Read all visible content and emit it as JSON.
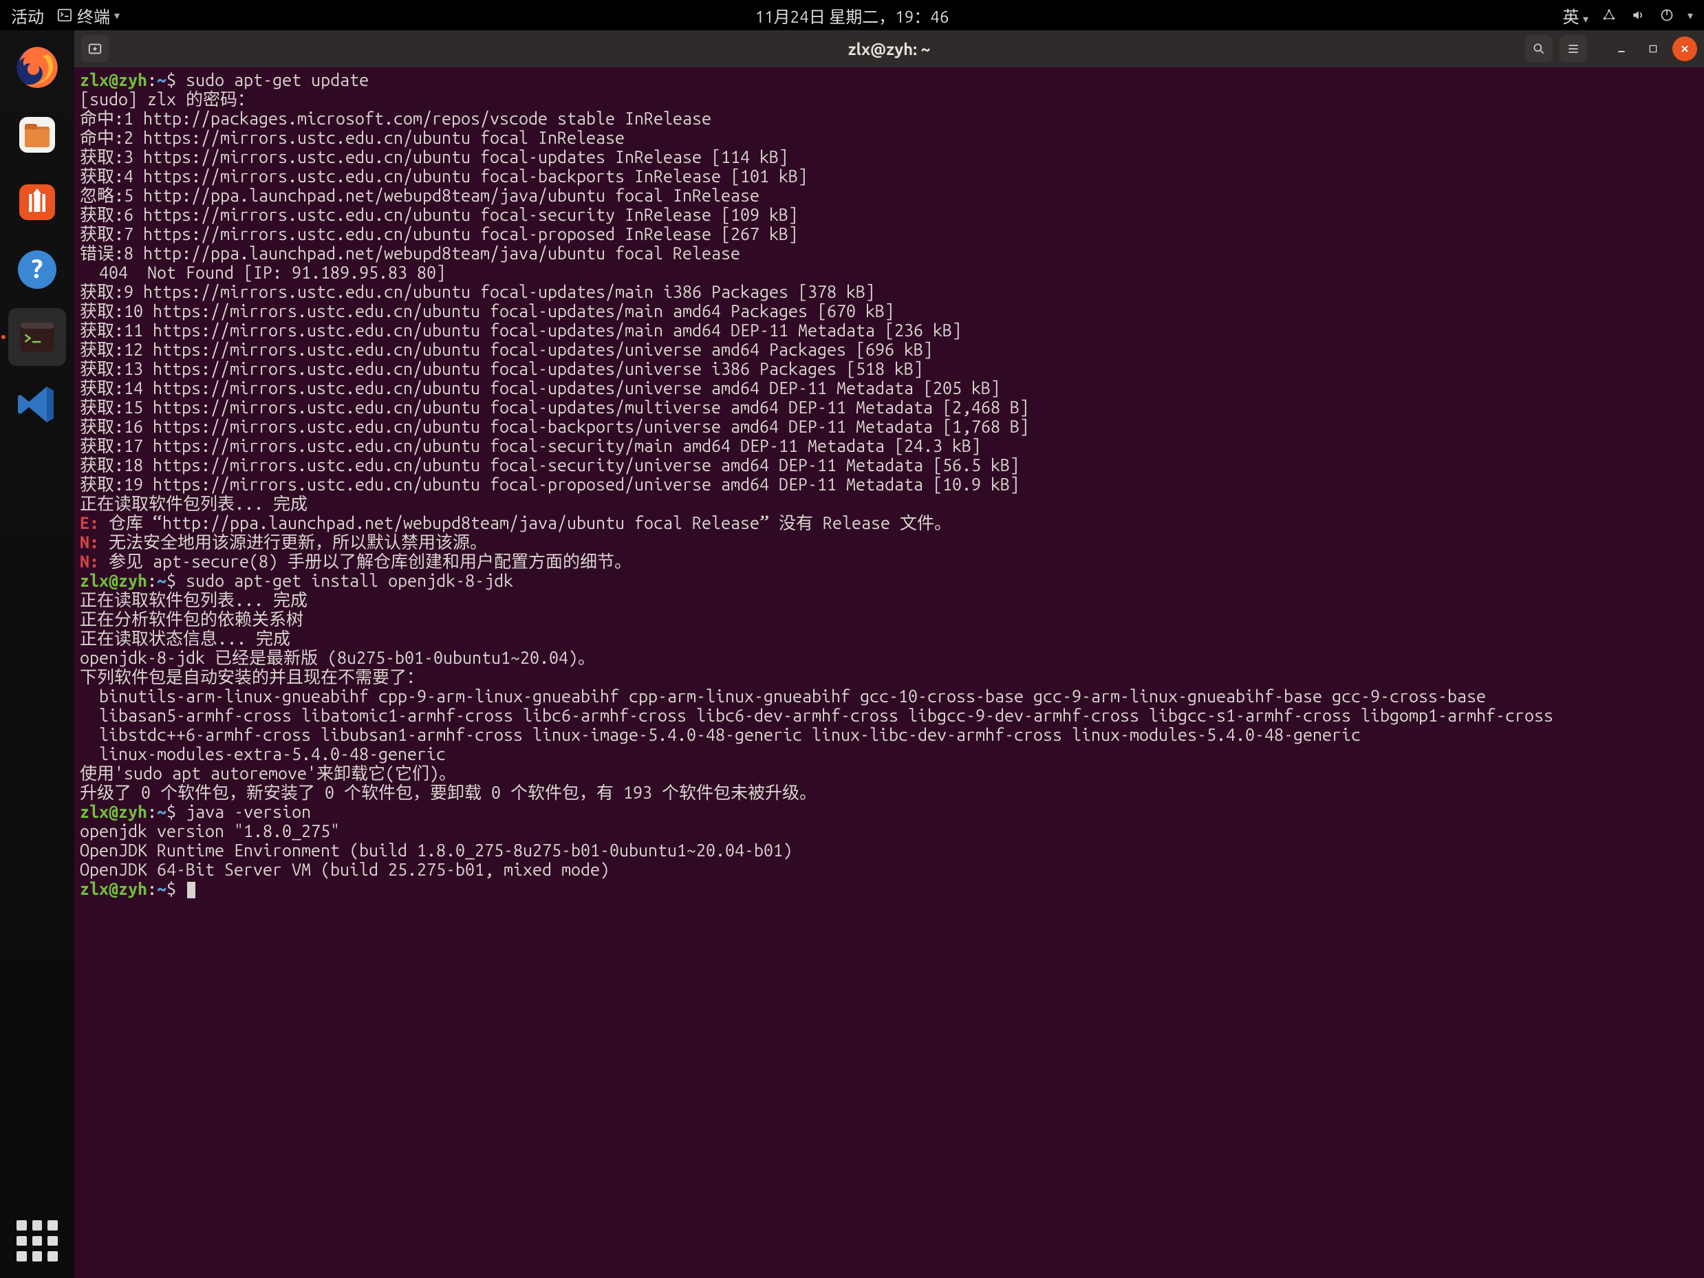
{
  "topbar": {
    "activities": "活动",
    "app_name": "终端",
    "clock": "11月24日 星期二，19：46",
    "input_method": "英"
  },
  "window": {
    "title": "zlx@zyh: ~"
  },
  "prompt": {
    "user_host": "zlx@zyh",
    "sep1": ":",
    "path": "~",
    "dollar": "$"
  },
  "commands": {
    "c1": " sudo apt-get update",
    "c2": " sudo apt-get install openjdk-8-jdk",
    "c3": " java -version"
  },
  "output": {
    "l01": "[sudo] zlx 的密码：",
    "l02": "命中:1 http://packages.microsoft.com/repos/vscode stable InRelease",
    "l03": "命中:2 https://mirrors.ustc.edu.cn/ubuntu focal InRelease",
    "l04": "获取:3 https://mirrors.ustc.edu.cn/ubuntu focal-updates InRelease [114 kB]",
    "l05": "获取:4 https://mirrors.ustc.edu.cn/ubuntu focal-backports InRelease [101 kB]",
    "l06": "忽略:5 http://ppa.launchpad.net/webupd8team/java/ubuntu focal InRelease",
    "l07": "获取:6 https://mirrors.ustc.edu.cn/ubuntu focal-security InRelease [109 kB]",
    "l08": "获取:7 https://mirrors.ustc.edu.cn/ubuntu focal-proposed InRelease [267 kB]",
    "l09": "错误:8 http://ppa.launchpad.net/webupd8team/java/ubuntu focal Release",
    "l10": "  404  Not Found [IP: 91.189.95.83 80]",
    "l11": "获取:9 https://mirrors.ustc.edu.cn/ubuntu focal-updates/main i386 Packages [378 kB]",
    "l12": "获取:10 https://mirrors.ustc.edu.cn/ubuntu focal-updates/main amd64 Packages [670 kB]",
    "l13": "获取:11 https://mirrors.ustc.edu.cn/ubuntu focal-updates/main amd64 DEP-11 Metadata [236 kB]",
    "l14": "获取:12 https://mirrors.ustc.edu.cn/ubuntu focal-updates/universe amd64 Packages [696 kB]",
    "l15": "获取:13 https://mirrors.ustc.edu.cn/ubuntu focal-updates/universe i386 Packages [518 kB]",
    "l16": "获取:14 https://mirrors.ustc.edu.cn/ubuntu focal-updates/universe amd64 DEP-11 Metadata [205 kB]",
    "l17": "获取:15 https://mirrors.ustc.edu.cn/ubuntu focal-updates/multiverse amd64 DEP-11 Metadata [2,468 B]",
    "l18": "获取:16 https://mirrors.ustc.edu.cn/ubuntu focal-backports/universe amd64 DEP-11 Metadata [1,768 B]",
    "l19": "获取:17 https://mirrors.ustc.edu.cn/ubuntu focal-security/main amd64 DEP-11 Metadata [24.3 kB]",
    "l20": "获取:18 https://mirrors.ustc.edu.cn/ubuntu focal-security/universe amd64 DEP-11 Metadata [56.5 kB]",
    "l21": "获取:19 https://mirrors.ustc.edu.cn/ubuntu focal-proposed/universe amd64 DEP-11 Metadata [10.9 kB]",
    "l22": "正在读取软件包列表... 完成",
    "l23_e": "E: ",
    "l23": "仓库 “http://ppa.launchpad.net/webupd8team/java/ubuntu focal Release” 没有 Release 文件。",
    "l24_n": "N: ",
    "l24": "无法安全地用该源进行更新，所以默认禁用该源。",
    "l25_n": "N: ",
    "l25": "参见 apt-secure(8) 手册以了解仓库创建和用户配置方面的细节。",
    "l26": "正在读取软件包列表... 完成",
    "l27": "正在分析软件包的依赖关系树       ",
    "l28": "正在读取状态信息... 完成       ",
    "l29": "openjdk-8-jdk 已经是最新版 (8u275-b01-0ubuntu1~20.04)。",
    "l30": "下列软件包是自动安装的并且现在不需要了：",
    "l31": "  binutils-arm-linux-gnueabihf cpp-9-arm-linux-gnueabihf cpp-arm-linux-gnueabihf gcc-10-cross-base gcc-9-arm-linux-gnueabihf-base gcc-9-cross-base",
    "l32": "  libasan5-armhf-cross libatomic1-armhf-cross libc6-armhf-cross libc6-dev-armhf-cross libgcc-9-dev-armhf-cross libgcc-s1-armhf-cross libgomp1-armhf-cross",
    "l33": "  libstdc++6-armhf-cross libubsan1-armhf-cross linux-image-5.4.0-48-generic linux-libc-dev-armhf-cross linux-modules-5.4.0-48-generic",
    "l34": "  linux-modules-extra-5.4.0-48-generic",
    "l35": "使用'sudo apt autoremove'来卸载它(它们)。",
    "l36": "升级了 0 个软件包，新安装了 0 个软件包，要卸载 0 个软件包，有 193 个软件包未被升级。",
    "l37": "openjdk version \"1.8.0_275\"",
    "l38": "OpenJDK Runtime Environment (build 1.8.0_275-8u275-b01-0ubuntu1~20.04-b01)",
    "l39": "OpenJDK 64-Bit Server VM (build 25.275-b01, mixed mode)"
  }
}
